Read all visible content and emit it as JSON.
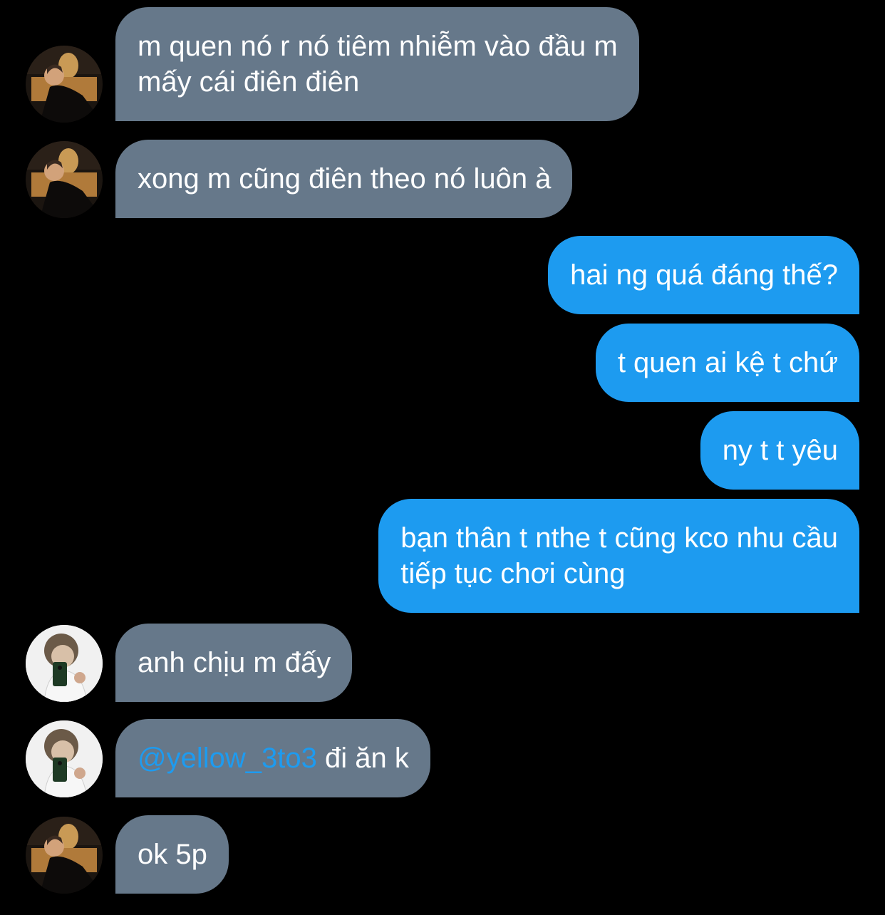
{
  "conversation": {
    "messages": [
      {
        "direction": "incoming",
        "avatar": "avatar-a",
        "lines": [
          "m quen nó r nó tiêm nhiễm vào đầu m",
          "mấy cái điên điên"
        ]
      },
      {
        "direction": "incoming",
        "avatar": "avatar-a",
        "lines": [
          "xong m cũng điên theo nó luôn à"
        ]
      },
      {
        "direction": "outgoing",
        "lines": [
          "hai ng quá đáng thế?"
        ]
      },
      {
        "direction": "outgoing",
        "lines": [
          "t quen ai kệ t chứ"
        ]
      },
      {
        "direction": "outgoing",
        "lines": [
          "ny t t yêu"
        ]
      },
      {
        "direction": "outgoing",
        "lines": [
          "bạn thân t nthe t cũng kco nhu cầu",
          "tiếp tục chơi cùng"
        ]
      },
      {
        "direction": "incoming",
        "avatar": "avatar-b",
        "lines": [
          "anh chịu m đấy"
        ]
      },
      {
        "direction": "incoming",
        "avatar": "avatar-b",
        "mention": "@yellow_3to3",
        "text_after_mention": " đi ăn k"
      },
      {
        "direction": "incoming",
        "avatar": "avatar-a",
        "lines": [
          "ok 5p"
        ]
      }
    ]
  },
  "colors": {
    "background": "#000000",
    "incoming_bubble": "#66788a",
    "outgoing_bubble": "#1d9bf0",
    "mention": "#1d9bf0"
  }
}
